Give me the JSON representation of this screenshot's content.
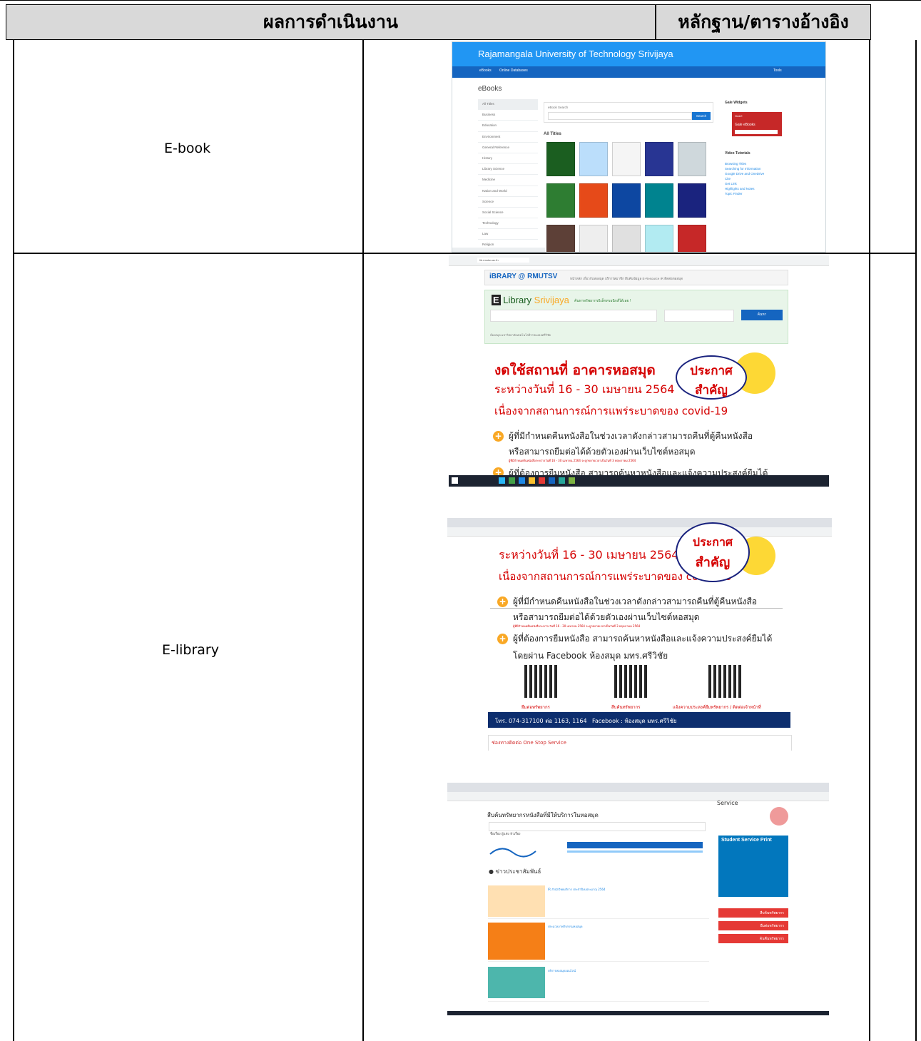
{
  "header": {
    "col1": "ผลการดำเนินงาน",
    "col2": "หลักฐาน/ตารางอ้างอิง"
  },
  "rows": [
    {
      "label": "E-book"
    },
    {
      "label": "E-library"
    }
  ],
  "ebook_shot": {
    "site_title": "Rajamangala University of Technology Srivijaya",
    "nav_items": [
      "eBooks",
      "Online Databases"
    ],
    "nav_tools": "Tools",
    "heading": "eBooks",
    "categories": [
      "All Titles",
      "Business",
      "Education",
      "Environment",
      "General Reference",
      "History",
      "Library Science",
      "Medicine",
      "Nation and World",
      "Science",
      "Social Science",
      "Technology",
      "Law",
      "Religion"
    ],
    "search_label": "eBook Search",
    "search_button": "Search",
    "all_titles": "All Titles",
    "gale_widgets": "Gale Widgets",
    "gale_badge": "GALE",
    "gale_ebooks": "Gale eBooks",
    "video_tutorials": "Video Tutorials",
    "tutorials": [
      "Browsing Titles",
      "Searching for Information",
      "Google Drive and OneDrive",
      "Cite",
      "Get Link",
      "Highlights and Notes",
      "Topic Finder"
    ],
    "book_colors": [
      "#1b5e20",
      "#bbdefb",
      "#f5f5f5",
      "#283593",
      "#cfd8dc",
      "#2e7d32",
      "#e64a19",
      "#0d47a1",
      "#00838f",
      "#1a237e",
      "#5d4037",
      "#eeeeee",
      "#e0e0e0",
      "#b2ebf2",
      "#c62828"
    ]
  },
  "elibrary_shot1": {
    "address": "lib.rmutsv.ac.th",
    "logo": "iBRARY @ RMUTSV",
    "nav_text": "หน้าหลัก  เกี่ยวกับหอสมุด  บริการสมาชิก  สืบค้นข้อมูล  E-Resource  IR  ติดต่อหอสมุด",
    "elib_prefix": "Library",
    "elib_brand": "Srivijaya",
    "elib_sub": "ค้นหาทรัพยากรอิเล็กทรอนิกส์ได้เลย !",
    "search_btn": "ค้นหา",
    "foot": "ห้องสมุด มหาวิทยาลัยเทคโนโลยีราชมงคลศรีวิชัย",
    "notice1": "งดใช้สถานที่ อาคารหอสมุด",
    "notice2": "ระหว่างวันที่ 16 - 30 เมษายน 2564",
    "notice3": "เนื่องจากสถานการณ์การแพร่ระบาดของ covid-19",
    "oval_top": "ประกาศ",
    "oval_bottom": "สำคัญ",
    "bullet1_a": "ผู้ที่มีกำหนดคืนหนังสือในช่วงเวลาดังกล่าวสามารถคืนที่ตู้คืนหนังสือ",
    "bullet1_b": "หรือสามารถยืมต่อได้ด้วยตัวเองผ่านเว็บไซต์หอสมุด",
    "bullet1_c": "ผู้ที่มีกำหนดคืนหนังสือระหว่างวันที่ 16 - 30 เมษายน 2564 จะถูกขยายเวลาเป็นวันที่ 3 พฤษภาคม 2564",
    "bullet2_a": "ผู้ที่ต้องการยืมหนังสือ สามารถค้นหาหนังสือและแจ้งความประสงค์ยืมได้"
  },
  "elibrary_shot2": {
    "notice2": "ระหว่างวันที่ 16 - 30 เมษายน 2564",
    "notice3": "เนื่องจากสถานการณ์การแพร่ระบาดของ covid-19",
    "oval_top": "ประกาศ",
    "oval_bottom": "สำคัญ",
    "bullet1_a": "ผู้ที่มีกำหนดคืนหนังสือในช่วงเวลาดังกล่าวสามารถคืนที่ตู้คืนหนังสือ",
    "bullet1_b": "หรือสามารถยืมต่อได้ด้วยตัวเองผ่านเว็บไซต์หอสมุด",
    "bullet1_c": "ผู้ที่มีกำหนดคืนหนังสือระหว่างวันที่ 16 - 30 เมษายน 2564 จะถูกขยายเวลาเป็นวันที่ 3 พฤษภาคม 2564",
    "bullet2_a": "ผู้ที่ต้องการยืมหนังสือ สามารถค้นหาหนังสือและแจ้งความประสงค์ยืมได้",
    "bullet2_b": "โดยผ่าน Facebook ห้องสมุด มทร.ศรีวิชัย",
    "qr1": "ยืมต่อทรัพยากร",
    "qr2": "สืบค้นทรัพยากร",
    "qr3": "แจ้งความประสงค์ยืมทรัพยากร / ติดต่อเจ้าหน้าที่",
    "tel": "โทร. 074-317100 ต่อ 1163, 1164",
    "facebook": "Facebook : ห้องสมุด มทร.ศรีวิชัย",
    "channel": "ช่องทางติดต่อ One Stop Service"
  },
  "elibrary_shot3": {
    "service": "Service",
    "search_title": "สืบค้นทรัพยากรหนังสือที่มีให้บริการในหอสมุด",
    "search_btn": "ค้นหา",
    "radio": "ชื่อเรื่อง  ผู้แต่ง  หัวเรื่อง",
    "news": "ข่าวประชาสัมพันธ์",
    "student_print": "Student Service Print",
    "btn1": "สืบค้นทรัพยากร",
    "btn2": "ยืมต่อทรัพยากร",
    "btn3": "ค้นคืนทรัพยากร",
    "items": [
      "IR สำนักวิทยบริการ ประจำปีงบประมาณ 2564",
      "ประมวลภาพกิจกรรมหอสมุด",
      "บริการหอสมุดออนไลน์"
    ]
  }
}
